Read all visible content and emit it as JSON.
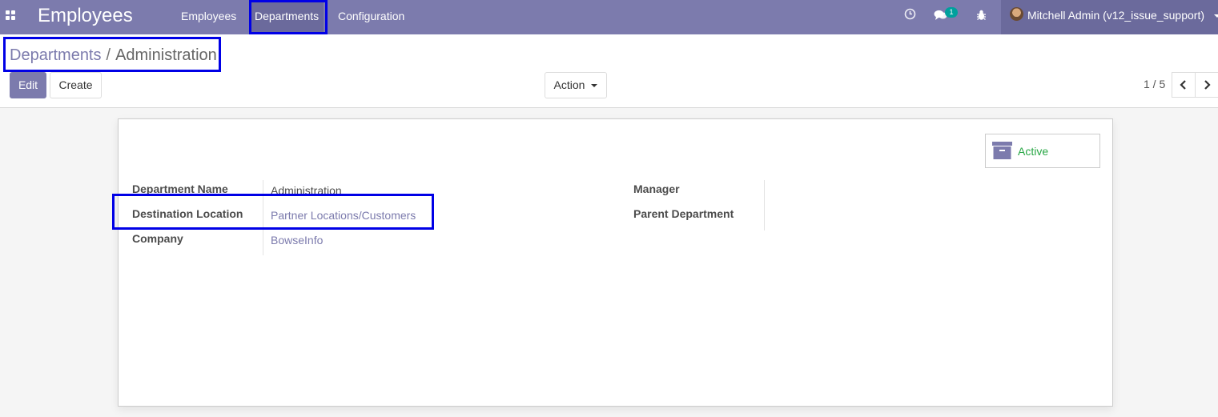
{
  "navbar": {
    "app_name": "Employees",
    "menu": [
      {
        "label": "Employees",
        "active": false
      },
      {
        "label": "Departments",
        "active": true
      },
      {
        "label": "Configuration",
        "active": false
      }
    ],
    "messages_badge": "1",
    "user_name": "Mitchell Admin (v12_issue_support)",
    "icons": [
      "apps-icon",
      "clock-icon",
      "chat-icon",
      "bug-icon",
      "avatar",
      "chevron-down-icon"
    ]
  },
  "breadcrumb": {
    "parent": "Departments",
    "separator": "/",
    "current": "Administration"
  },
  "toolbar": {
    "edit_label": "Edit",
    "create_label": "Create",
    "action_label": "Action"
  },
  "pager": {
    "value": "1 / 5"
  },
  "form": {
    "archive_button": "Active",
    "fields_left": [
      {
        "label": "Department Name",
        "value": "Administration",
        "is_link": false
      },
      {
        "label": "Destination Location",
        "value": "Partner Locations/Customers",
        "is_link": true
      },
      {
        "label": "Company",
        "value": "BowseInfo",
        "is_link": true
      }
    ],
    "fields_right": [
      {
        "label": "Manager",
        "value": ""
      },
      {
        "label": "Parent Department",
        "value": ""
      }
    ]
  },
  "colors": {
    "navbar": "#7c7bad",
    "link": "#7c7bad",
    "active_status": "#28a745",
    "highlight": "#0000e6"
  }
}
